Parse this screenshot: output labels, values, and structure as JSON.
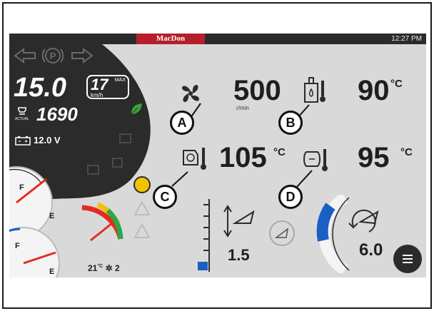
{
  "header": {
    "brand": "MacDon",
    "time": "12:27 PM"
  },
  "left_panel": {
    "speed": "15.0",
    "max_speed": "17",
    "max_label": "MAX",
    "speed_unit": "km/h",
    "engine_rpm": "1690",
    "actual_label": "ACTUAL",
    "battery_voltage": "12.0 V",
    "fuel_gauge_labels": {
      "full": "F",
      "empty": "E"
    },
    "def_gauge_labels": {
      "full": "F",
      "empty": "E"
    },
    "ambient_temp": "21",
    "ambient_unit": "°C",
    "fan_setting": "2"
  },
  "readouts": {
    "fan_speed": "500",
    "fan_speed_unit": "r/min",
    "hydraulic_temp": "90",
    "hydraulic_temp_unit": "°C",
    "coolant_temp": "105",
    "coolant_temp_unit": "°C",
    "intake_temp": "95",
    "intake_temp_unit": "°C",
    "header_height": "1.5",
    "reel_speed": "6.0"
  },
  "callouts": {
    "a": "A",
    "b": "B",
    "c": "C",
    "d": "D"
  },
  "icons": [
    "turn-left-icon",
    "parking-brake-icon",
    "turn-right-icon",
    "eco-leaf-icon",
    "fan-icon",
    "hydraulic-oil-temp-icon",
    "coolant-temp-icon",
    "intake-temp-icon",
    "header-height-icon",
    "header-tilt-icon",
    "reel-icon",
    "menu-icon",
    "warning-icon",
    "battery-icon",
    "engine-icon"
  ],
  "colors": {
    "brand": "#b51f2a",
    "top_bar": "#2b2b2b",
    "gauge_blue": "#1a5fc4",
    "eco_green": "#3aa63a",
    "warning_yellow": "#f2c200"
  }
}
